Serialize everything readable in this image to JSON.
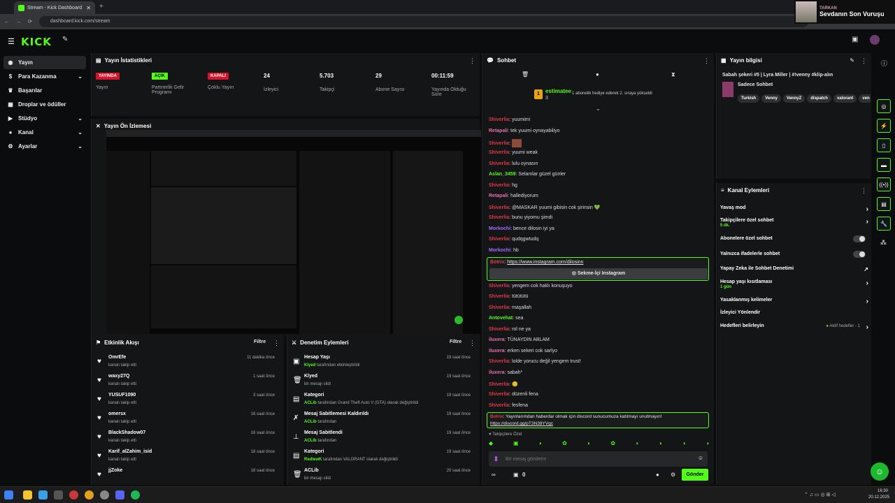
{
  "browser": {
    "tab_title": "Stream - Kick Dashboard",
    "url": "dashboard.kick.com/stream"
  },
  "now_playing": {
    "artist": "TARKAN",
    "song": "Sevdanın Son Vuruşu"
  },
  "brand": {
    "logo": "KICK",
    "accent": "#53fc18"
  },
  "sidebar": {
    "items": [
      {
        "label": "Yayın",
        "icon": "broadcast-icon"
      },
      {
        "label": "Para Kazanma",
        "icon": "dollar-icon"
      },
      {
        "label": "Başarılar",
        "icon": "trophy-icon"
      },
      {
        "label": "Droplar ve ödüller",
        "icon": "gift-icon"
      },
      {
        "label": "Stüdyo",
        "icon": "studio-icon"
      },
      {
        "label": "Kanal",
        "icon": "person-icon"
      },
      {
        "label": "Ayarlar",
        "icon": "gear-icon"
      }
    ]
  },
  "stats": {
    "title": "Yayın İstatistikleri",
    "items": [
      {
        "badge": "YAYINDA",
        "label": "Yayın"
      },
      {
        "badge": "AÇIK",
        "label": "Partnerlik Gelir Programı"
      },
      {
        "badge": "KAPALI",
        "label": "Çoklu Yayın"
      },
      {
        "value": "24",
        "label": "İzleyici"
      },
      {
        "value": "5.703",
        "label": "Takipçi"
      },
      {
        "value": "29",
        "label": "Abone Sayısı"
      },
      {
        "value": "00:11:59",
        "label": "Yayında Olduğu Süre"
      }
    ]
  },
  "preview": {
    "title": "Yayın Ön İzlemesi"
  },
  "activity": {
    "title": "Etkinlik Akışı",
    "filter": "Filtre",
    "rows": [
      {
        "name": "OmrEfe",
        "sub": "kanalı takip etti",
        "time": "11 dakika önce"
      },
      {
        "name": "waxy27Q",
        "sub": "kanalı takip etti",
        "time": "1 saat önce"
      },
      {
        "name": "YUSUF1090",
        "sub": "kanalı takip etti",
        "time": "3 saat önce"
      },
      {
        "name": "omersx",
        "sub": "kanalı takip etti",
        "time": "16 saat önce"
      },
      {
        "name": "BlackShadow07",
        "sub": "kanalı takip etti",
        "time": "16 saat önce"
      },
      {
        "name": "Karif_alZahim_isid",
        "sub": "kanalı takip etti",
        "time": "18 saat önce"
      },
      {
        "name": "jjZoke",
        "sub": "kanalı takip etti",
        "time": "18 saat önce"
      }
    ]
  },
  "moderation": {
    "title": "Denetim Eylemleri",
    "filter": "Filtre",
    "rows": [
      {
        "title": "Hesap Yaşı",
        "actor": "Klyed",
        "rest": "tarafından etkinleştirildi",
        "time": "19 saat önce"
      },
      {
        "title": "Klyed",
        "actor": "",
        "rest": "bir mesajı sildi",
        "time": "19 saat önce"
      },
      {
        "title": "Kategori",
        "actor": "ACLib",
        "rest": "tarafından Grand Theft Auto V (GTA) olarak değiştirildi",
        "time": "19 saat önce"
      },
      {
        "title": "Mesaj Sabitlemesi Kaldırıldı",
        "actor": "ACLib",
        "rest": "tarafından",
        "time": "19 saat önce"
      },
      {
        "title": "Mesaj Sabitlendi",
        "actor": "ACLib",
        "rest": "tarafından",
        "time": "19 saat önce"
      },
      {
        "title": "Kategori",
        "actor": "RedlewK",
        "rest": "tarafından VALORANT olarak değiştirildi",
        "time": "19 saat önce"
      },
      {
        "title": "ACLib",
        "actor": "",
        "rest": "bir mesajı sildi",
        "time": "20 saat önce"
      }
    ]
  },
  "chat": {
    "title": "Sohbet",
    "gifter": "estimatee",
    "gifter_count": "3",
    "gift_note": "1 abonelik hediye ederek 2. sıraya yükseldi",
    "messages": [
      {
        "user": "Shiverlia",
        "color": "red",
        "text": "yuumimi"
      },
      {
        "user": "Retapali",
        "color": "pink",
        "text": "tek yuumi oynayabiliyo"
      },
      {
        "user": "Shiverlia",
        "color": "red",
        "text": ""
      },
      {
        "user": "Shiverlia",
        "color": "red",
        "text": "yuumi weak"
      },
      {
        "user": "Shiverlia",
        "color": "red",
        "text": "lulu oynasın"
      },
      {
        "user": "Aslan_3459",
        "color": "green",
        "text": "Selamlar güzel günler"
      },
      {
        "user": "Shiverlia",
        "color": "red",
        "text": "hg"
      },
      {
        "user": "Retapali",
        "color": "pink",
        "text": "hallediyorum"
      },
      {
        "user": "Shiverlia",
        "color": "red",
        "text": "@MASKAR yuumi gibisin cok şirinsin 💚"
      },
      {
        "user": "Shiverlia",
        "color": "red",
        "text": "bunu yiyomu şimdi"
      },
      {
        "user": "Morkochi",
        "color": "purple",
        "text": "bence dilosin iyi ya"
      },
      {
        "user": "Shiverlia",
        "color": "red",
        "text": "qudqgwtudq"
      },
      {
        "user": "Morkochi",
        "color": "purple",
        "text": "hb"
      }
    ],
    "pinned_link": {
      "user": "Botrix",
      "text": "https://www.instagram.com/dilosinn",
      "button": "Sekme-İçi Instagram"
    },
    "messages2": [
      {
        "user": "Shiverlia",
        "color": "red",
        "text": "yengem cok haklı konuşuyo"
      },
      {
        "user": "Shiverlia",
        "color": "red",
        "text": "tütütütü"
      },
      {
        "user": "Shiverlia",
        "color": "red",
        "text": "maşallah"
      },
      {
        "user": "Antovehat",
        "color": "green",
        "text": "sea"
      },
      {
        "user": "Shiverlia",
        "color": "red",
        "text": "rol ne ya"
      },
      {
        "user": "iluxera",
        "color": "pink",
        "text": "TÜNAYDIN ABLAM"
      },
      {
        "user": "iluxera",
        "color": "pink",
        "text": "erken sekeri cok sarlyo"
      },
      {
        "user": "Shiverlia",
        "color": "red",
        "text": "lolde yorucu değil yengem trust!"
      },
      {
        "user": "iluxera",
        "color": "pink",
        "text": "sabah*"
      },
      {
        "user": "Shiverlia",
        "color": "red",
        "text": "😊"
      },
      {
        "user": "Shiverlia",
        "color": "red",
        "text": "düzenli fena"
      },
      {
        "user": "Shiverlia",
        "color": "red",
        "text": "fesfena"
      }
    ],
    "discord_msg": {
      "user": "Botrix",
      "text": "Yayınlarımdan haberdar olmak için discord sunucumuza katılmayı unutmayın!",
      "link": "https://discord.gg/pT3N38YVgc"
    },
    "followers_only": "Takipçilere Özel",
    "input_placeholder": "Bir mesaj gönderin",
    "points": "0",
    "send_label": "Gönder"
  },
  "stream_info": {
    "title": "Yayın bilgisi",
    "stream_title": "Sabah şekeri #5 | Lyra Miller | #!venny #klip-alın",
    "category": "Sadece Sohbet",
    "tags": [
      "Turkish",
      "Venny",
      "VennyZ",
      "dispatch",
      "valorant",
      "ven"
    ]
  },
  "channel_actions": {
    "title": "Kanal Eylemleri",
    "rows": [
      {
        "label": "Yavaş mod",
        "sub": ""
      },
      {
        "label": "Takipçilere özel sohbet",
        "sub": "5 dk."
      },
      {
        "label": "Abonelere özel sohbet",
        "sub": ""
      },
      {
        "label": "Yalnızca ifadelerle sohbet",
        "sub": ""
      },
      {
        "label": "Yapay Zeka ile Sohbet Denetimi",
        "sub": ""
      },
      {
        "label": "Hesap yaşı kısıtlaması",
        "sub": "1 gün"
      },
      {
        "label": "Yasaklanmış kelimeler",
        "sub": ""
      },
      {
        "label": "İzleyici Yönlendir",
        "sub": ""
      },
      {
        "label": "Hedefleri belirleyin",
        "sub": ""
      }
    ],
    "goals_status": "Aktif hedefler - 1"
  },
  "taskbar": {
    "time": "16:30",
    "date": "20.12.2025"
  }
}
